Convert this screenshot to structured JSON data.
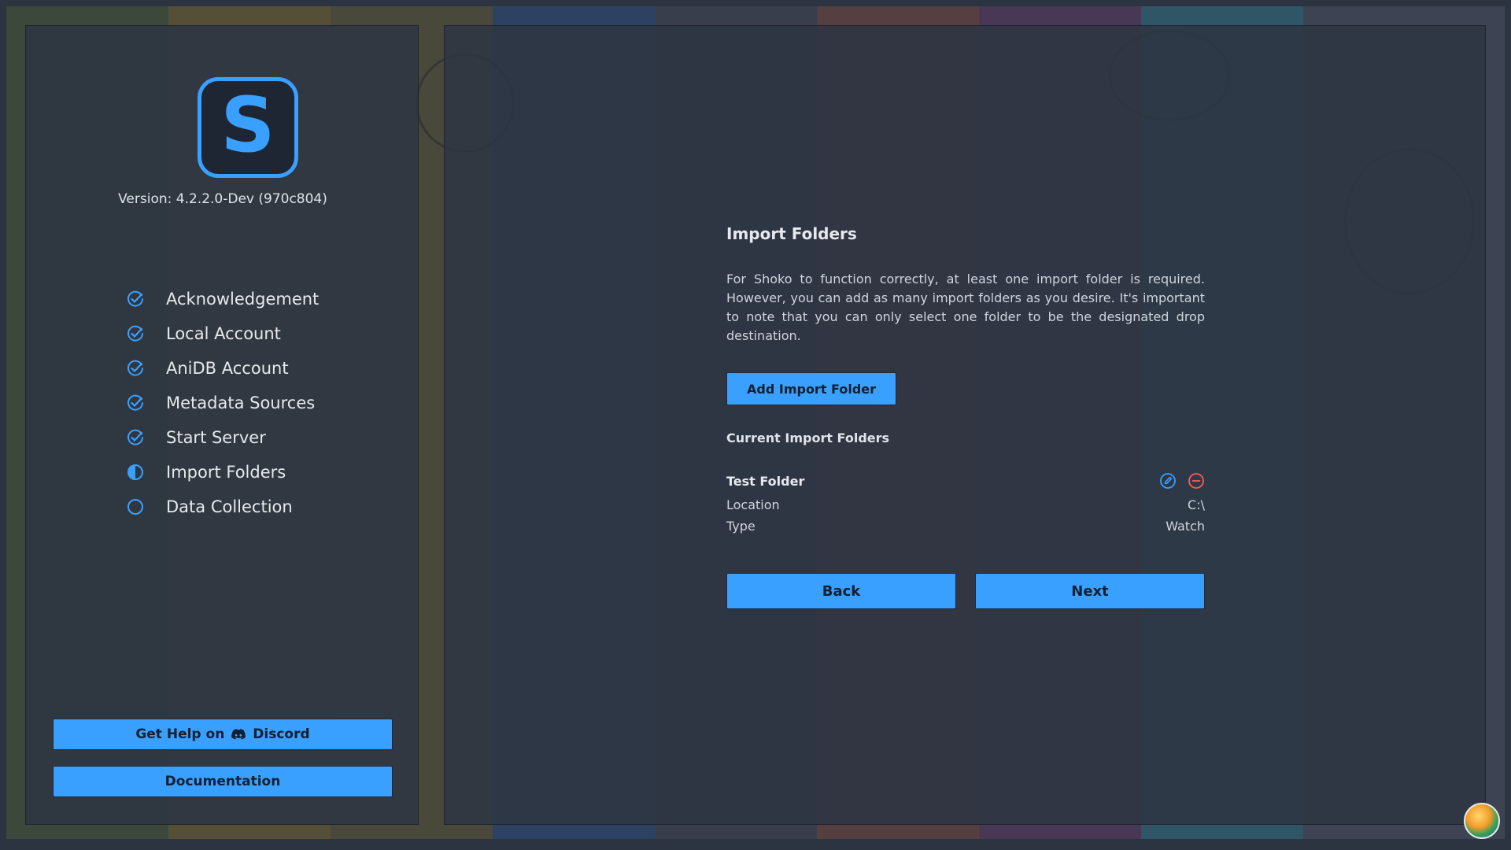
{
  "app": {
    "logo_letter": "S",
    "version": "Version: 4.2.2.0-Dev (970c804)",
    "accent": "#3aa0ff"
  },
  "steps": [
    {
      "label": "Acknowledgement",
      "state": "complete",
      "icon": "check-circle-icon"
    },
    {
      "label": "Local Account",
      "state": "complete",
      "icon": "check-circle-icon"
    },
    {
      "label": "AniDB Account",
      "state": "complete",
      "icon": "check-circle-icon"
    },
    {
      "label": "Metadata Sources",
      "state": "complete",
      "icon": "check-circle-icon"
    },
    {
      "label": "Start Server",
      "state": "complete",
      "icon": "check-circle-icon"
    },
    {
      "label": "Import Folders",
      "state": "current",
      "icon": "half-circle-icon"
    },
    {
      "label": "Data Collection",
      "state": "pending",
      "icon": "empty-circle-icon"
    }
  ],
  "sidebar_buttons": {
    "help_prefix": "Get Help on",
    "help_suffix": "Discord",
    "documentation": "Documentation"
  },
  "page": {
    "title": "Import Folders",
    "description": "For Shoko to function correctly, at least one import folder is required. However, you can add as many import folders as you desire. It's important to note that you can only select one folder to be the designated drop destination.",
    "add_button": "Add Import Folder",
    "current_heading": "Current Import Folders"
  },
  "folder": {
    "name": "Test Folder",
    "location_label": "Location",
    "location_value": "C:\\",
    "type_label": "Type",
    "type_value": "Watch"
  },
  "nav": {
    "back": "Back",
    "next": "Next"
  },
  "colors": {
    "edit_icon": "#3aa0ff",
    "remove_icon": "#ff5a5a"
  }
}
